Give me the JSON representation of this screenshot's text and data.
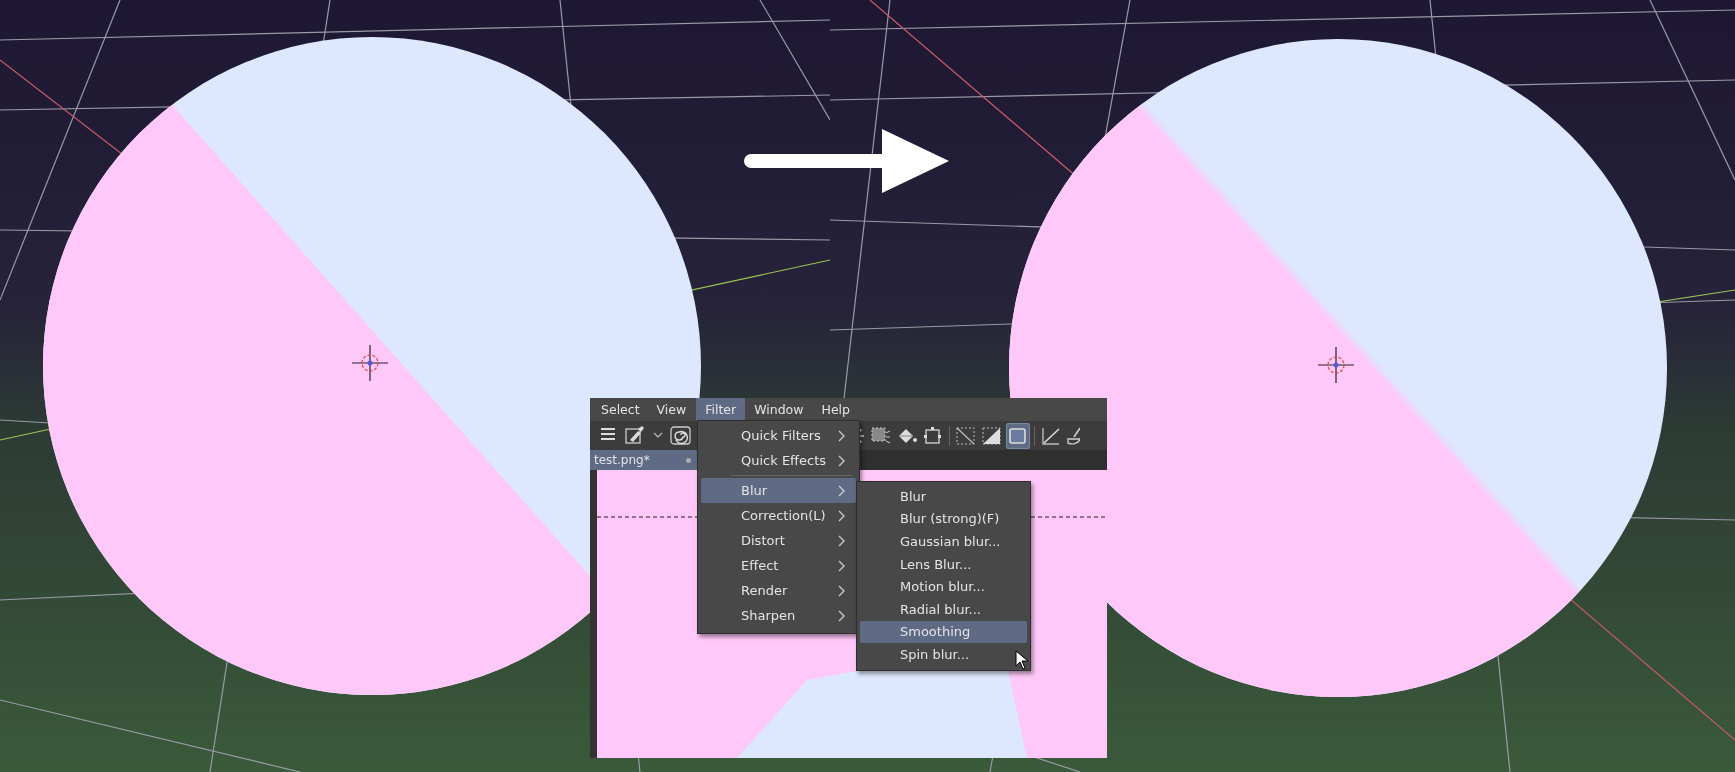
{
  "viewports": [
    {
      "smoothed": false
    },
    {
      "smoothed": true
    }
  ],
  "app_window": {
    "menu_bar": [
      {
        "label": "Select",
        "selected": false
      },
      {
        "label": "View",
        "selected": false
      },
      {
        "label": "Filter",
        "selected": true
      },
      {
        "label": "Window",
        "selected": false
      },
      {
        "label": "Help",
        "selected": false
      }
    ],
    "toolbar": {
      "left_tools": [
        {
          "kind": "menu",
          "selected": false
        },
        {
          "kind": "brush",
          "selected": false
        },
        {
          "kind": "caret",
          "selected": false
        },
        {
          "kind": "spiral",
          "selected": false
        }
      ],
      "right_groups": [
        [
          {
            "kind": "sparkle",
            "selected": false
          },
          {
            "kind": "marquee",
            "selected": false
          },
          {
            "kind": "bucket",
            "selected": false
          },
          {
            "kind": "transform",
            "selected": false
          }
        ],
        [
          {
            "kind": "clear",
            "selected": false
          },
          {
            "kind": "invert",
            "selected": false
          },
          {
            "kind": "frame",
            "selected": true
          }
        ],
        [
          {
            "kind": "ruler",
            "selected": false
          },
          {
            "kind": "pen",
            "selected": false
          }
        ]
      ]
    },
    "tab": {
      "label": "test.png*"
    },
    "filter_menu": {
      "groups": [
        [
          {
            "label": "Quick Filters",
            "has_submenu": true,
            "selected": false
          },
          {
            "label": "Quick Effects",
            "has_submenu": true,
            "selected": false
          }
        ],
        [
          {
            "label": "Blur",
            "has_submenu": true,
            "selected": true
          },
          {
            "label": "Correction(L)",
            "has_submenu": true,
            "selected": false
          },
          {
            "label": "Distort",
            "has_submenu": true,
            "selected": false
          },
          {
            "label": "Effect",
            "has_submenu": true,
            "selected": false
          },
          {
            "label": "Render",
            "has_submenu": true,
            "selected": false
          },
          {
            "label": "Sharpen",
            "has_submenu": true,
            "selected": false
          }
        ]
      ]
    },
    "blur_submenu": [
      {
        "label": "Blur",
        "selected": false
      },
      {
        "label": "Blur (strong)(F)",
        "selected": false
      },
      {
        "label": "Gaussian blur...",
        "selected": false
      },
      {
        "label": "Lens Blur...",
        "selected": false
      },
      {
        "label": "Motion blur...",
        "selected": false
      },
      {
        "label": "Radial blur...",
        "selected": false
      },
      {
        "label": "Smoothing",
        "selected": true
      },
      {
        "label": "Spin blur...",
        "selected": false
      }
    ]
  }
}
